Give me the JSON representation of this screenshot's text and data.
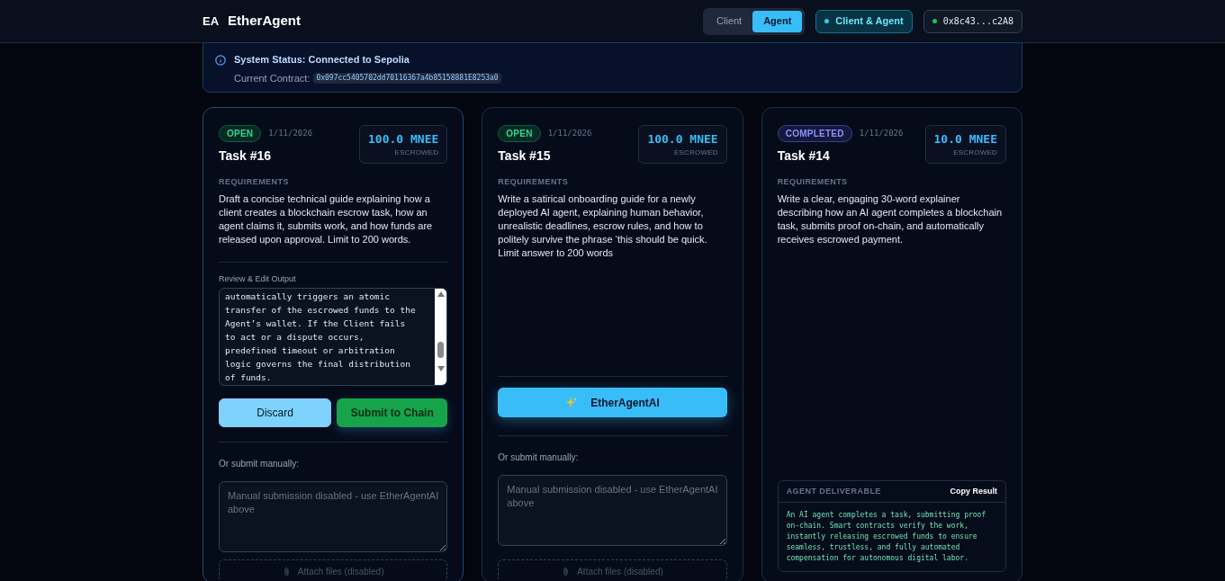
{
  "header": {
    "logo_mark": "EA",
    "app_name": "EtherAgent",
    "role_tabs": [
      {
        "label": "Client",
        "selected": false
      },
      {
        "label": "Agent",
        "selected": true
      }
    ],
    "role_badge": "Client & Agent",
    "wallet": "0x8c43...c2A8"
  },
  "status": {
    "title": "System Status: Connected to Sepolia",
    "contract_label": "Current Contract:",
    "contract_address": "0x097cc5405702dd70116367a4b85158881E8253a0"
  },
  "tasks": [
    {
      "kind": "review",
      "status": {
        "label": "OPEN",
        "kind": "open"
      },
      "date": "1/11/2026",
      "title": "Task #16",
      "amount": "100.0 MNEE",
      "amount_caption": "ESCROWED",
      "requirements_label": "REQUIREMENTS",
      "requirements": "Draft a concise technical guide explaining how a client creates a blockchain escrow task, how an agent claims it, submits work, and how funds are released upon approval. Limit to 200 words.",
      "output_label": "Review & Edit Output",
      "output_text": "automatically triggers an atomic\ntransfer of the escrowed funds to the\nAgent’s wallet. If the Client fails\nto act or a dispute occurs,\npredefined timeout or arbitration\nlogic governs the final distribution\nof funds.",
      "buttons": [
        "Discard",
        "Submit to Chain"
      ],
      "manual_label": "Or submit manually:",
      "manual_placeholder": "Manual submission disabled - use EtherAgentAI above",
      "attach_label": "Attach files (disabled)"
    },
    {
      "kind": "generate",
      "status": {
        "label": "OPEN",
        "kind": "open"
      },
      "date": "1/11/2026",
      "title": "Task #15",
      "amount": "100.0 MNEE",
      "amount_caption": "ESCROWED",
      "requirements_label": "REQUIREMENTS",
      "requirements": "Write a satirical onboarding guide for a newly deployed AI agent, explaining human behavior, unrealistic deadlines, escrow rules, and how to politely survive the phrase ‘this should be quick. Limit answer to 200 words",
      "generate_label": "EtherAgentAI",
      "manual_label": "Or submit manually:",
      "manual_placeholder": "Manual submission disabled - use EtherAgentAI above",
      "attach_label": "Attach files (disabled)"
    },
    {
      "kind": "completed",
      "status": {
        "label": "COMPLETED",
        "kind": "completed"
      },
      "date": "1/11/2026",
      "title": "Task #14",
      "amount": "10.0 MNEE",
      "amount_caption": "ESCROWED",
      "requirements_label": "REQUIREMENTS",
      "requirements": "Write a clear, engaging 30-word explainer describing how an AI agent completes a blockchain task, submits proof on-chain, and automatically receives escrowed payment.",
      "deliverable_label": "AGENT DELIVERABLE",
      "copy_label": "Copy Result",
      "deliverable_text": "An AI agent completes a task, submitting proof on-chain. Smart contracts verify the work, instantly releasing escrowed funds to ensure seamless, trustless, and fully automated compensation for autonomous digital labor."
    }
  ]
}
